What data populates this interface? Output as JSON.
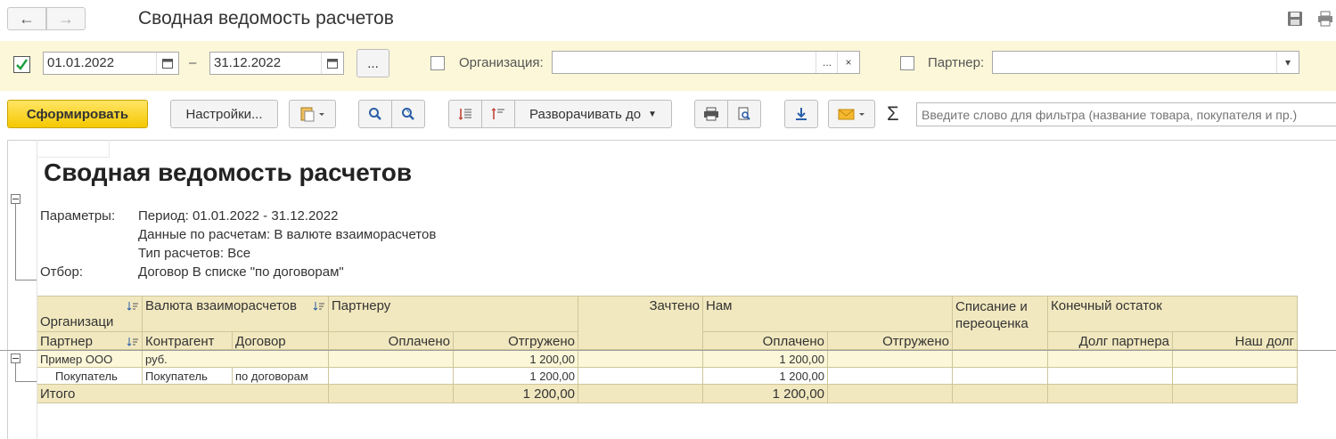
{
  "window": {
    "title": "Сводная ведомость расчетов"
  },
  "filters": {
    "period_enabled": true,
    "date_from": "01.01.2022",
    "date_sep": "–",
    "date_to": "31.12.2022",
    "more_label": "...",
    "org_label": "Организация:",
    "org_value": "",
    "org_more": "...",
    "org_clear": "×",
    "partner_label": "Партнер:",
    "partner_value": ""
  },
  "toolbar": {
    "generate_label": "Сформировать",
    "settings_label": "Настройки...",
    "expand_label": "Разворачивать до",
    "sum_icon": "Σ",
    "search_placeholder": "Введите слово для фильтра (название товара, покупателя и пр.)"
  },
  "report": {
    "title": "Сводная ведомость расчетов",
    "params_label": "Параметры:",
    "params": [
      "Период: 01.01.2022 - 31.12.2022",
      "Данные по расчетам: В валюте взаиморасчетов",
      "Тип расчетов: Все"
    ],
    "filter_label": "Отбор:",
    "filter_value": "Договор В списке \"по договорам\""
  },
  "table": {
    "h_org": "Организаци\nя",
    "h_currency": "Валюта взаиморасчетов",
    "h_partner_to": "Партнеру",
    "h_offset": "Зачтено",
    "h_us": "Нам",
    "h_writeoff": "Списание и\nпереоценка",
    "h_end": "Конечный остаток",
    "h_partner": "Партнер",
    "h_counterparty": "Контрагент",
    "h_contract": "Договор",
    "h_paid": "Оплачено",
    "h_shipped": "Отгружено",
    "h_us_paid": "Оплачено",
    "h_us_shipped": "Отгружено",
    "h_debt_partner": "Долг партнера",
    "h_our_debt": "Наш долг",
    "rows": [
      {
        "org": "Пример ООО",
        "currency": "руб.",
        "shipped": "1 200,00",
        "us_paid": "1 200,00"
      },
      {
        "partner": "Покупатель",
        "counterparty": "Покупатель",
        "contract": "по договорам",
        "shipped": "1 200,00",
        "us_paid": "1 200,00"
      }
    ],
    "total": {
      "label": "Итого",
      "shipped": "1 200,00",
      "us_paid": "1 200,00"
    }
  }
}
